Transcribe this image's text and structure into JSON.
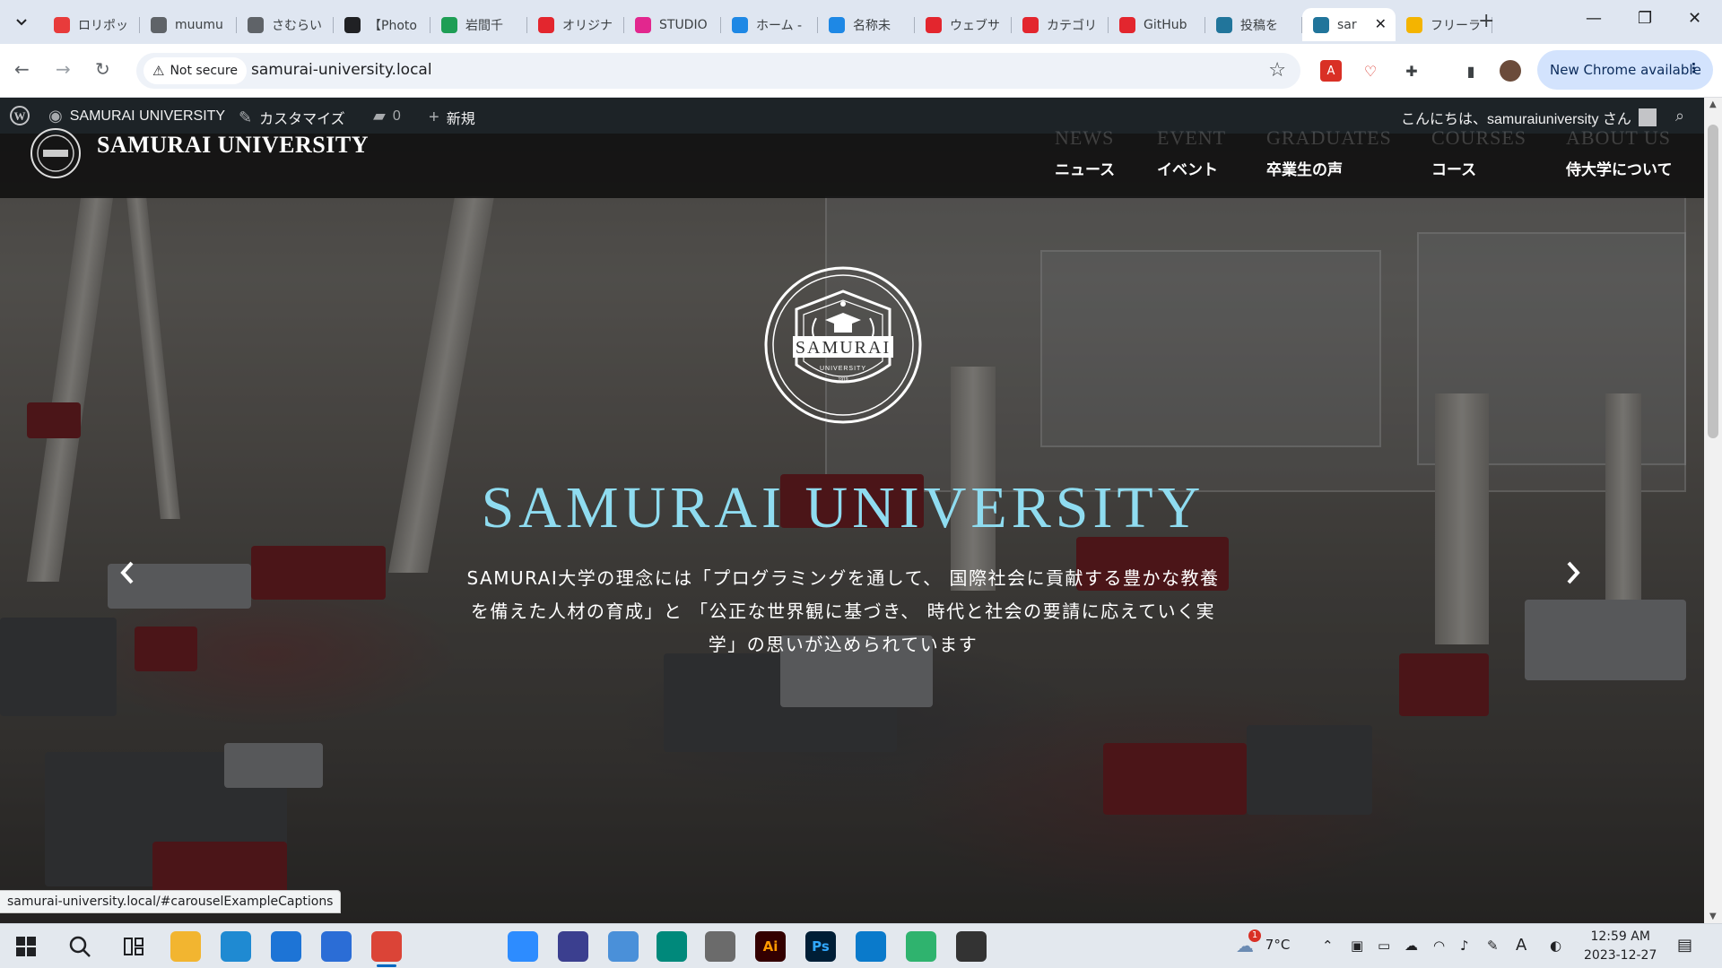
{
  "browser": {
    "tabs": [
      {
        "title": "ロリポッ",
        "icon": "lolipop-icon",
        "color": "#e83b3b"
      },
      {
        "title": "muumu",
        "icon": "gmail-icon",
        "color": "#5f6368"
      },
      {
        "title": "さむらい",
        "icon": "globe-icon",
        "color": "#5f6368"
      },
      {
        "title": "【Photo",
        "icon": "cat-icon",
        "color": "#202124"
      },
      {
        "title": "岩間千",
        "icon": "sheets-icon",
        "color": "#1e9e55"
      },
      {
        "title": "オリジナ",
        "icon": "samurai-icon",
        "color": "#e3262e"
      },
      {
        "title": "STUDIO",
        "icon": "studio-icon",
        "color": "#e2278e"
      },
      {
        "title": "ホーム -",
        "icon": "canva-icon",
        "color": "#1e88e5"
      },
      {
        "title": "名称未",
        "icon": "canva-icon",
        "color": "#1e88e5"
      },
      {
        "title": "ウェブサ",
        "icon": "samurai-icon",
        "color": "#e3262e"
      },
      {
        "title": "カテゴリ",
        "icon": "samurai-icon",
        "color": "#e3262e"
      },
      {
        "title": "GitHub",
        "icon": "samurai-icon",
        "color": "#e3262e"
      },
      {
        "title": "投稿を",
        "icon": "wordpress-icon",
        "color": "#21759b"
      },
      {
        "title": "sar",
        "icon": "wordpress-icon",
        "color": "#21759b",
        "active": true
      },
      {
        "title": "フリーラ",
        "icon": "drive-icon",
        "color": "#f4b400"
      }
    ],
    "new_tab": "+",
    "security_label": "Not secure",
    "url": "samurai-university.local",
    "update_label": "New Chrome available"
  },
  "admin_bar": {
    "site_name": "SAMURAI UNIVERSITY",
    "customize": "カスタマイズ",
    "comments_count": "0",
    "new": "新規",
    "greeting": "こんにちは、samuraiuniversity さん"
  },
  "site": {
    "title": "SAMURAI UNIVERSITY",
    "menu": [
      {
        "en": "NEWS",
        "ja": "ニュース"
      },
      {
        "en": "EVENT",
        "ja": "イベント"
      },
      {
        "en": "GRADUATES",
        "ja": "卒業生の声"
      },
      {
        "en": "COURSES",
        "ja": "コース"
      },
      {
        "en": "ABOUT US",
        "ja": "侍大学について"
      }
    ]
  },
  "hero": {
    "emblem_text": "SAMURAI",
    "emblem_sub": "UNIVERSITY",
    "emblem_year": "1919",
    "title": "SAMURAI UNIVERSITY",
    "description": "SAMURAI大学の理念には「プログラミングを通して、 国際社会に貢献する豊かな教養を備えた人材の育成」と 「公正な世界観に基づき、 時代と社会の要請に応えていく実学」の思いが込められています",
    "prev": "‹",
    "next": "›",
    "title_color": "#8fdcf0"
  },
  "status_bar": {
    "link": "samurai-university.local/#carouselExampleCaptions"
  },
  "taskbar": {
    "weather": "7°C",
    "weather_badge": "1",
    "time": "12:59 AM",
    "date": "2023-12-27",
    "apps": [
      {
        "name": "file-explorer-icon",
        "color": "#f2b530"
      },
      {
        "name": "edge-icon",
        "color": "#1f8ad2"
      },
      {
        "name": "mail-icon",
        "color": "#1d74d6"
      },
      {
        "name": "store-icon",
        "color": "#2b6dd6"
      },
      {
        "name": "chrome-icon",
        "color": "#db4437"
      },
      {
        "name": "zoom-icon",
        "color": "#2d8cff"
      },
      {
        "name": "video-editor-icon",
        "color": "#3b3f8f"
      },
      {
        "name": "remote-desktop-icon",
        "color": "#4a90d9"
      },
      {
        "name": "meet-icon",
        "color": "#00897b"
      },
      {
        "name": "spiral-icon",
        "color": "#6b6b6b"
      },
      {
        "name": "illustrator-icon",
        "color": "#330000",
        "label": "Ai"
      },
      {
        "name": "photoshop-icon",
        "color": "#001e36",
        "label": "Ps"
      },
      {
        "name": "vscode-icon",
        "color": "#0a7acb"
      },
      {
        "name": "diamond-app-icon",
        "color": "#2fb36e"
      },
      {
        "name": "line-app-icon",
        "color": "#333333"
      }
    ]
  }
}
